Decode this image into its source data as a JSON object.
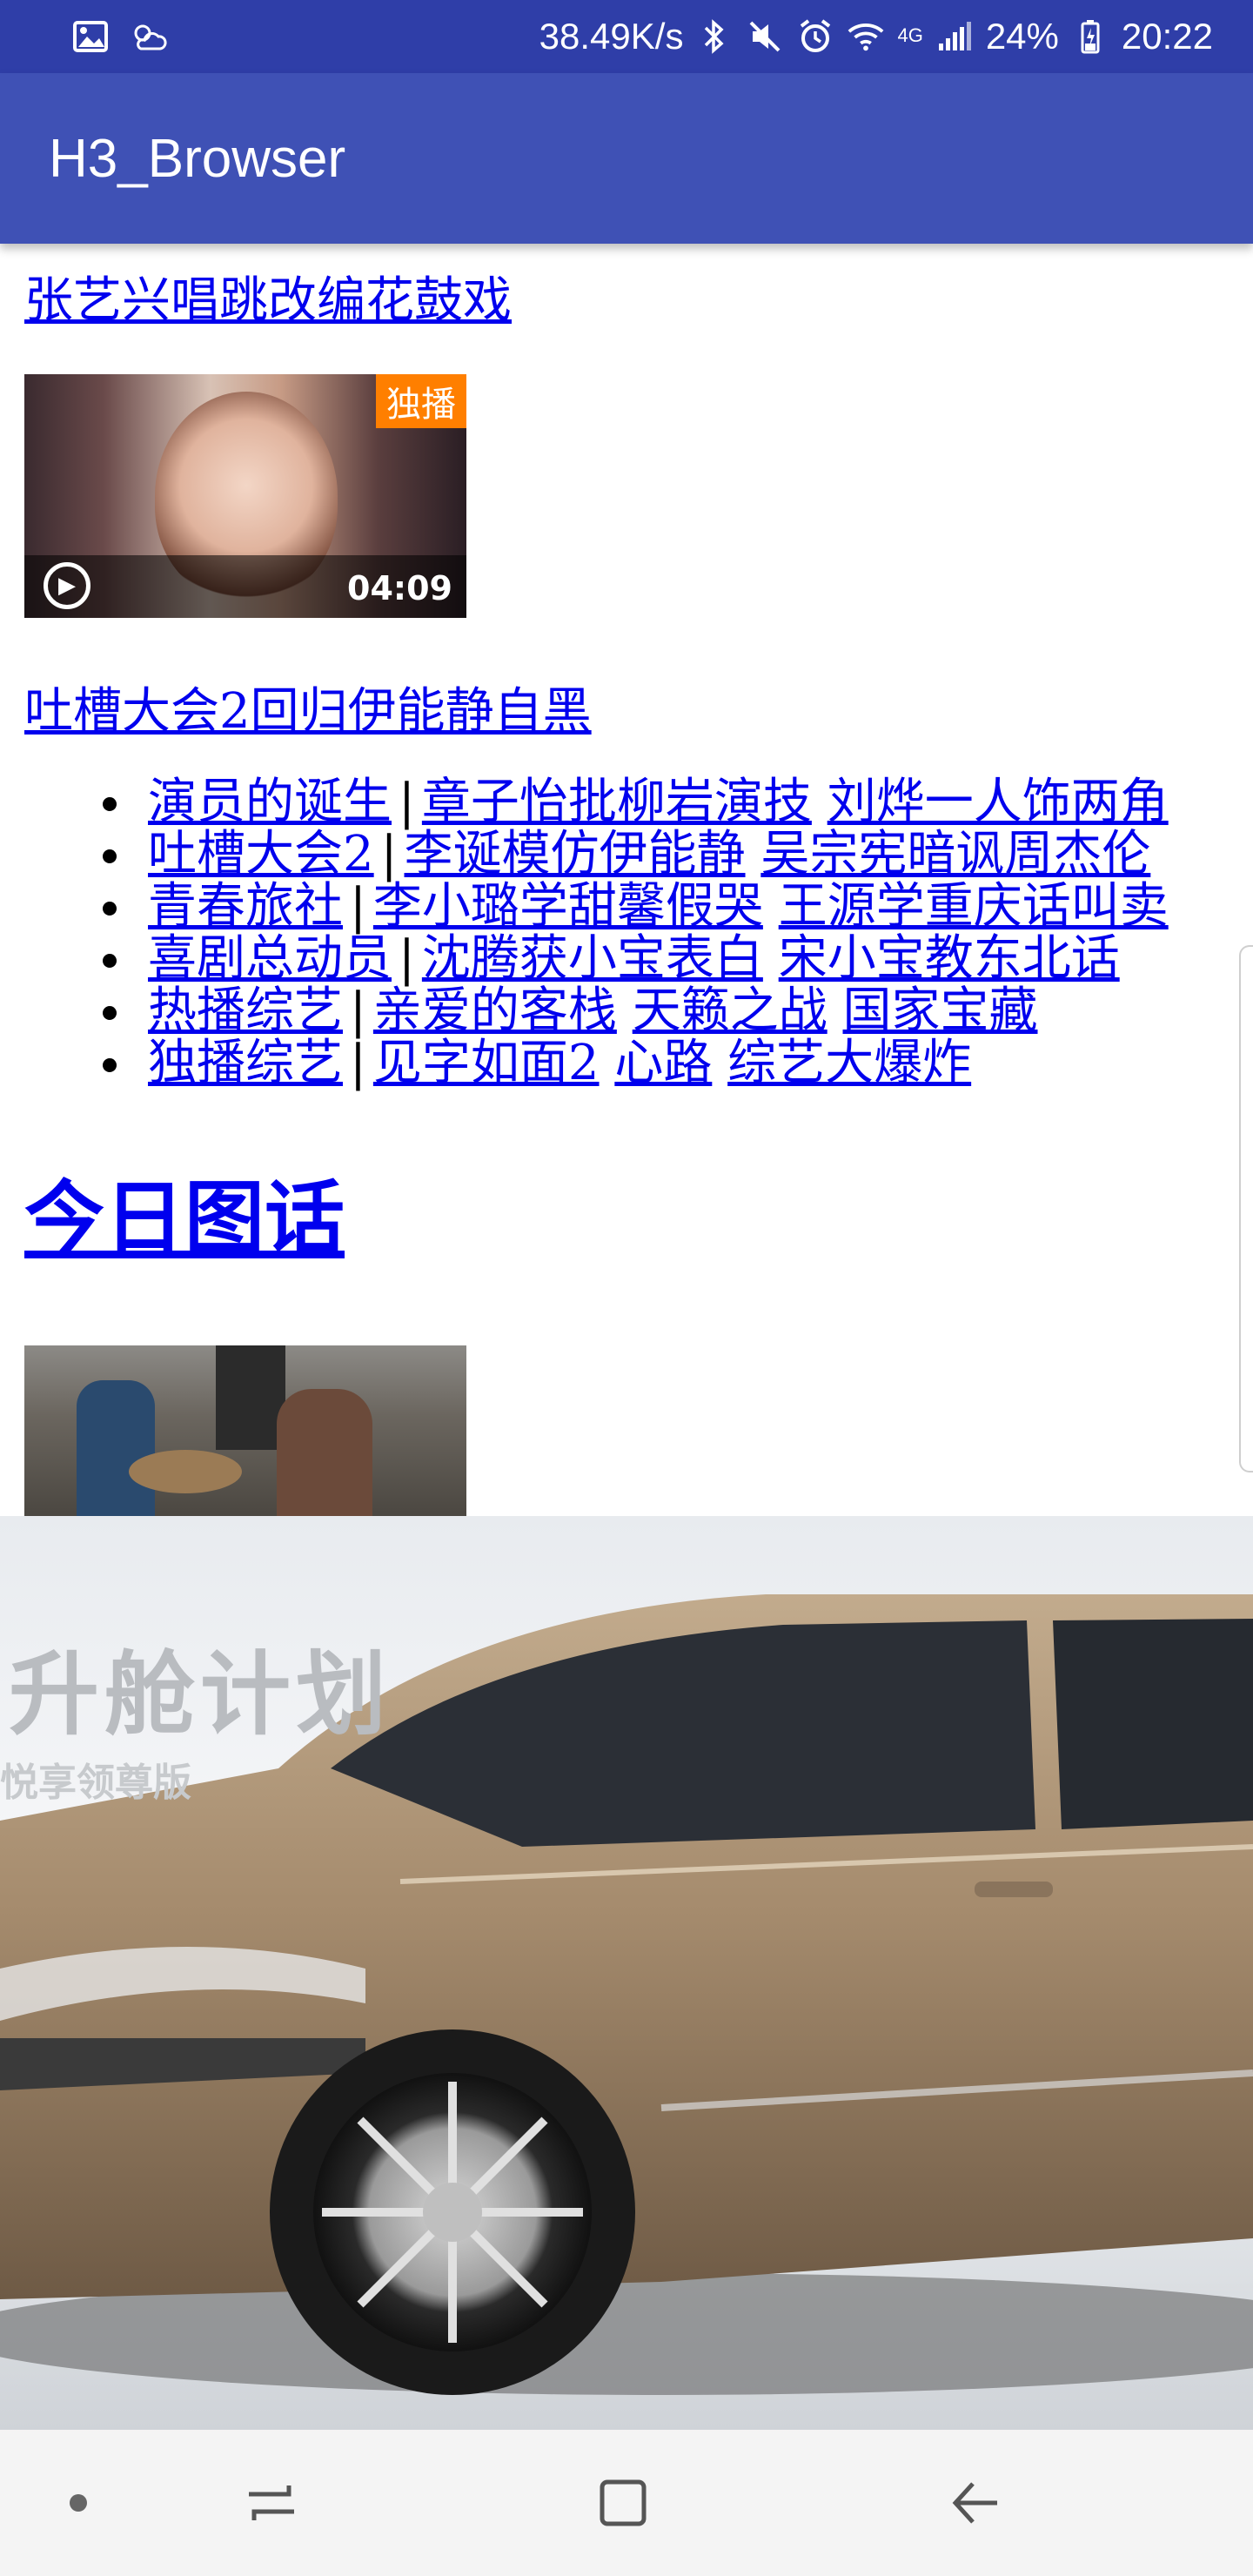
{
  "status_bar": {
    "network_speed": "38.49K/s",
    "network_type": "4G",
    "battery": "24%",
    "time": "20:22",
    "icons": [
      "image-icon",
      "weather-icon",
      "bluetooth-icon",
      "mute-icon",
      "alarm-icon",
      "wifi-icon",
      "signal-icon",
      "battery-icon"
    ]
  },
  "app_bar": {
    "title": "H3_Browser"
  },
  "page": {
    "headline1": "张艺兴唱跳改编花鼓戏",
    "video": {
      "badge": "独播",
      "duration": "04:09"
    },
    "headline2": "吐槽大会2回归伊能静自黑",
    "link_rows": [
      {
        "category": "演员的诞生",
        "items": [
          "章子怡批柳岩演技",
          "刘烨一人饰两角"
        ]
      },
      {
        "category": "吐槽大会2",
        "items": [
          "李诞模仿伊能静",
          "吴宗宪暗讽周杰伦"
        ]
      },
      {
        "category": "青春旅社",
        "items": [
          "李小璐学甜馨假哭",
          "王源学重庆话叫卖"
        ]
      },
      {
        "category": "喜剧总动员",
        "items": [
          "沈腾获小宝表白",
          "宋小宝教东北话"
        ]
      },
      {
        "category": "热播综艺",
        "items": [
          "亲爱的客栈",
          "天籁之战",
          "国家宝藏"
        ]
      },
      {
        "category": "独播综艺",
        "items": [
          "见字如面2",
          "心路",
          "综艺大爆炸"
        ]
      }
    ],
    "separator": "|",
    "section_title": "今日图话"
  },
  "ad": {
    "title": "升舱计划",
    "subtitle": "悦享领尊版",
    "car_color": "#a08a70"
  },
  "nav_bar": {
    "icons": [
      "dot-icon",
      "recent-apps-icon",
      "home-icon",
      "back-icon"
    ]
  },
  "colors": {
    "status_bar": "#2f3ea8",
    "app_bar": "#3f51b5",
    "link": "#0000ee"
  }
}
